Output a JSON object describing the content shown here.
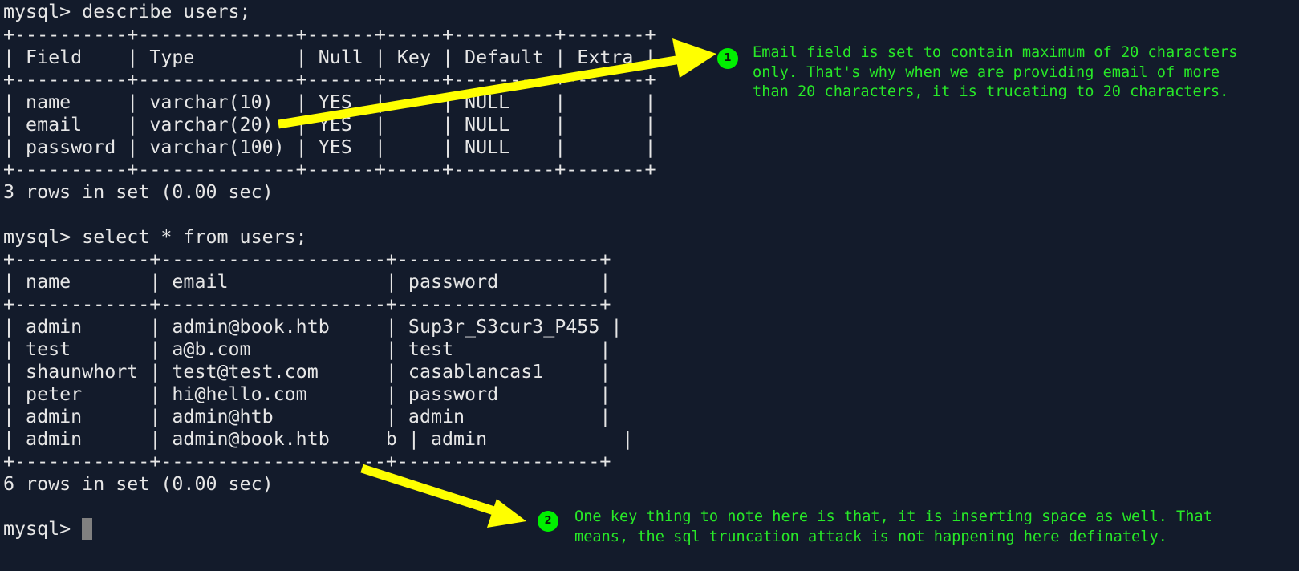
{
  "terminal": {
    "lines": [
      "mysql> describe users;",
      "+----------+--------------+------+-----+---------+-------+",
      "| Field    | Type         | Null | Key | Default | Extra |",
      "+----------+--------------+------+-----+---------+-------+",
      "| name     | varchar(10)  | YES  |     | NULL    |       |",
      "| email    | varchar(20)  | YES  |     | NULL    |       |",
      "| password | varchar(100) | YES  |     | NULL    |       |",
      "+----------+--------------+------+-----+---------+-------+",
      "3 rows in set (0.00 sec)",
      "",
      "mysql> select * from users;",
      "+------------+--------------------+------------------+",
      "| name       | email              | password         |",
      "+------------+--------------------+------------------+",
      "| admin      | admin@book.htb     | Sup3r_S3cur3_P455 |",
      "| test       | a@b.com            | test             |",
      "| shaunwhort | test@test.com      | casablancas1     |",
      "| peter      | hi@hello.com       | password         |",
      "| admin      | admin@htb          | admin            |",
      "| admin      | admin@book.htb     b | admin            |",
      "+------------+--------------------+------------------+",
      "6 rows in set (0.00 sec)",
      ""
    ],
    "prompt": "mysql> "
  },
  "annotations": [
    {
      "number": "1",
      "text": "Email field is set to contain maximum of 20 characters\nonly. That's why when we are providing email of more\nthan 20 characters, it is trucating to 20 characters."
    },
    {
      "number": "2",
      "text": "One key thing to note here is that, it is inserting space as well. That\nmeans, the sql truncation attack is not happening here definately."
    }
  ],
  "colors": {
    "background": "#131b2b",
    "terminal_text": "#e6e6e6",
    "annotation_text": "#28e828",
    "badge": "#00f000",
    "arrow": "#ffff00",
    "cursor": "#808080"
  }
}
